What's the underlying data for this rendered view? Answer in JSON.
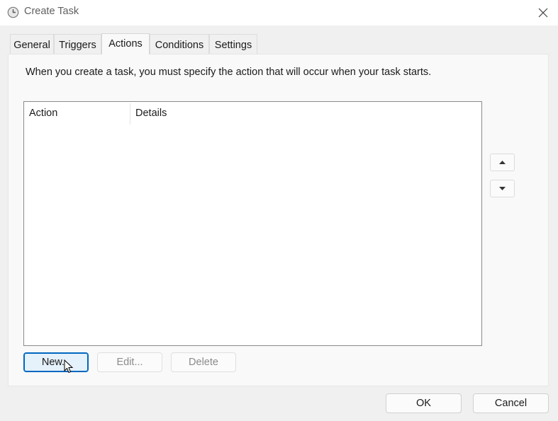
{
  "window": {
    "title": "Create Task"
  },
  "tabs": [
    {
      "label": "General"
    },
    {
      "label": "Triggers"
    },
    {
      "label": "Actions"
    },
    {
      "label": "Conditions"
    },
    {
      "label": "Settings"
    }
  ],
  "active_tab": "Actions",
  "actions_panel": {
    "instruction": "When you create a task, you must specify the action that will occur when your task starts.",
    "columns": [
      "Action",
      "Details"
    ],
    "rows": [],
    "buttons": {
      "new": "New...",
      "edit": "Edit...",
      "delete": "Delete"
    }
  },
  "footer": {
    "ok": "OK",
    "cancel": "Cancel"
  },
  "icons": {
    "app": "clock-icon",
    "close": "close-icon",
    "up": "move-up-icon",
    "down": "move-down-icon",
    "cursor": "mouse-pointer-icon"
  },
  "colors": {
    "focus_border": "#0067c0",
    "focus_fill": "#e5f1fb"
  }
}
